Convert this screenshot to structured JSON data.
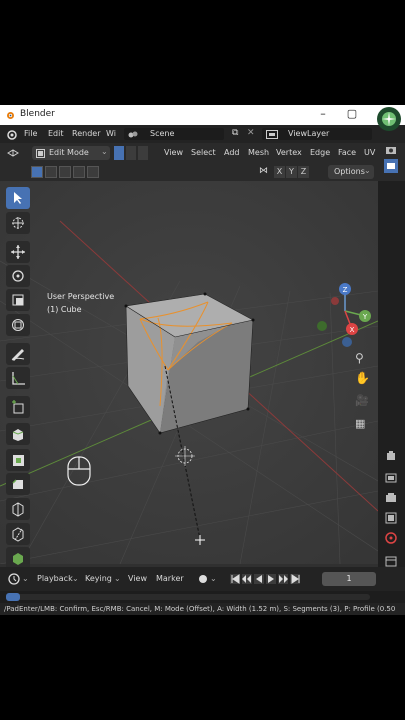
{
  "window": {
    "title": "Blender"
  },
  "menu": {
    "items": [
      "File",
      "Edit",
      "Render",
      "Wi"
    ],
    "scene": "Scene",
    "view_layer": "ViewLayer"
  },
  "header": {
    "mode": "Edit Mode",
    "menus": [
      "View",
      "Select",
      "Add",
      "Mesh",
      "Vertex",
      "Edge",
      "Face",
      "UV"
    ]
  },
  "tool_options": {
    "axes": [
      "X",
      "Y",
      "Z"
    ],
    "options_label": "Options"
  },
  "viewport": {
    "perspective": "User Perspective",
    "object": "(1) Cube",
    "accent": "#e8912e"
  },
  "timeline": {
    "playback": "Playback",
    "keying": "Keying",
    "view": "View",
    "marker": "Marker",
    "current_frame": "1"
  },
  "status_bar": "/PadEnter/LMB: Confirm, Esc/RMB: Cancel, M: Mode (Offset), A: Width (1.52 m), S: Segments (3), P: Profile (0.50"
}
